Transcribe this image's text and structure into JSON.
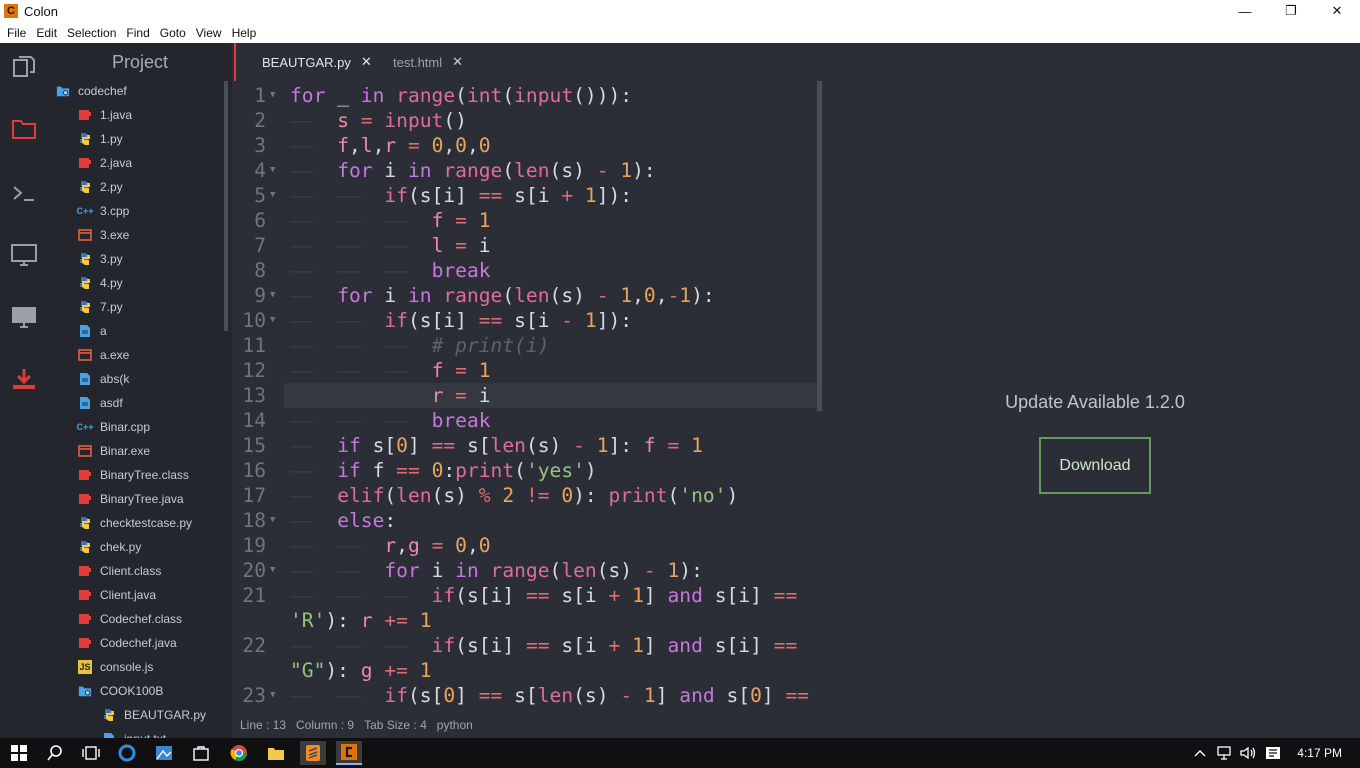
{
  "window": {
    "title": "Colon",
    "logo_letter": "C",
    "minimize": "—",
    "maximize": "❐",
    "close": "✕"
  },
  "menu": [
    "File",
    "Edit",
    "Selection",
    "Find",
    "Goto",
    "View",
    "Help"
  ],
  "sidebar": {
    "title": "Project",
    "items": [
      {
        "label": "codechef",
        "type": "folder"
      },
      {
        "label": "1.java",
        "type": "java"
      },
      {
        "label": "1.py",
        "type": "py"
      },
      {
        "label": "2.java",
        "type": "java"
      },
      {
        "label": "2.py",
        "type": "py"
      },
      {
        "label": "3.cpp",
        "type": "cpp"
      },
      {
        "label": "3.exe",
        "type": "exe"
      },
      {
        "label": "3.py",
        "type": "py"
      },
      {
        "label": "4.py",
        "type": "py"
      },
      {
        "label": "7.py",
        "type": "py"
      },
      {
        "label": "a",
        "type": "file"
      },
      {
        "label": "a.exe",
        "type": "exe"
      },
      {
        "label": "abs(k",
        "type": "file"
      },
      {
        "label": "asdf",
        "type": "file"
      },
      {
        "label": "Binar.cpp",
        "type": "cpp"
      },
      {
        "label": "Binar.exe",
        "type": "exe"
      },
      {
        "label": "BinaryTree.class",
        "type": "java"
      },
      {
        "label": "BinaryTree.java",
        "type": "java"
      },
      {
        "label": "checktestcase.py",
        "type": "py"
      },
      {
        "label": "chek.py",
        "type": "py"
      },
      {
        "label": "Client.class",
        "type": "java"
      },
      {
        "label": "Client.java",
        "type": "java"
      },
      {
        "label": "Codechef.class",
        "type": "java"
      },
      {
        "label": "Codechef.java",
        "type": "java"
      },
      {
        "label": "console.js",
        "type": "js"
      },
      {
        "label": "COOK100B",
        "type": "folder"
      },
      {
        "label": "BEAUTGAR.py",
        "type": "py"
      },
      {
        "label": "input.txt",
        "type": "file"
      }
    ]
  },
  "tabs": [
    {
      "label": "BEAUTGAR.py",
      "close": "✕",
      "active": true
    },
    {
      "label": "test.html",
      "close": "✕",
      "active": false
    }
  ],
  "editor": {
    "lines": [
      {
        "n": "1",
        "fold": "▼",
        "code": [
          [
            "kw",
            "for "
          ],
          [
            "",
            "_ "
          ],
          [
            "kw",
            "in "
          ],
          [
            "fn",
            "range"
          ],
          [
            "",
            "("
          ],
          [
            "fn",
            "int"
          ],
          [
            "",
            "("
          ],
          [
            "fn",
            "input"
          ],
          [
            "",
            "())):"
          ]
        ]
      },
      {
        "n": "2",
        "fold": "",
        "code": [
          [
            "guide",
            "——  "
          ],
          [
            "var",
            "s "
          ],
          [
            "op",
            "= "
          ],
          [
            "fn",
            "input"
          ],
          [
            "",
            "()"
          ]
        ]
      },
      {
        "n": "3",
        "fold": "",
        "code": [
          [
            "guide",
            "——  "
          ],
          [
            "var",
            "f"
          ],
          [
            "",
            ","
          ],
          [
            "var",
            "l"
          ],
          [
            "",
            ","
          ],
          [
            "var",
            "r "
          ],
          [
            "op",
            "= "
          ],
          [
            "num",
            "0"
          ],
          [
            "",
            ","
          ],
          [
            "num",
            "0"
          ],
          [
            "",
            ","
          ],
          [
            "num",
            "0"
          ]
        ]
      },
      {
        "n": "4",
        "fold": "▼",
        "code": [
          [
            "guide",
            "——  "
          ],
          [
            "kw",
            "for "
          ],
          [
            "",
            "i "
          ],
          [
            "kw",
            "in "
          ],
          [
            "fn",
            "range"
          ],
          [
            "",
            "("
          ],
          [
            "fn",
            "len"
          ],
          [
            "",
            "(s) "
          ],
          [
            "op",
            "- "
          ],
          [
            "num",
            "1"
          ],
          [
            "",
            "):"
          ]
        ]
      },
      {
        "n": "5",
        "fold": "▼",
        "code": [
          [
            "guide",
            "——  ——  "
          ],
          [
            "fn",
            "if"
          ],
          [
            "",
            "(s[i] "
          ],
          [
            "op",
            "== "
          ],
          [
            "",
            "s[i "
          ],
          [
            "op",
            "+ "
          ],
          [
            "num",
            "1"
          ],
          [
            "",
            "]):"
          ]
        ]
      },
      {
        "n": "6",
        "fold": "",
        "code": [
          [
            "guide",
            "——  ——  ——  "
          ],
          [
            "var",
            "f "
          ],
          [
            "op",
            "= "
          ],
          [
            "num",
            "1"
          ]
        ]
      },
      {
        "n": "7",
        "fold": "",
        "code": [
          [
            "guide",
            "——  ——  ——  "
          ],
          [
            "var",
            "l "
          ],
          [
            "op",
            "= "
          ],
          [
            "",
            "i"
          ]
        ]
      },
      {
        "n": "8",
        "fold": "",
        "code": [
          [
            "guide",
            "——  ——  ——  "
          ],
          [
            "kw",
            "break"
          ]
        ]
      },
      {
        "n": "9",
        "fold": "▼",
        "code": [
          [
            "guide",
            "——  "
          ],
          [
            "kw",
            "for "
          ],
          [
            "",
            "i "
          ],
          [
            "kw",
            "in "
          ],
          [
            "fn",
            "range"
          ],
          [
            "",
            "("
          ],
          [
            "fn",
            "len"
          ],
          [
            "",
            "(s) "
          ],
          [
            "op",
            "- "
          ],
          [
            "num",
            "1"
          ],
          [
            "",
            ","
          ],
          [
            "num",
            "0"
          ],
          [
            "",
            ","
          ],
          [
            "op",
            "-"
          ],
          [
            "num",
            "1"
          ],
          [
            "",
            "):"
          ]
        ]
      },
      {
        "n": "10",
        "fold": "▼",
        "code": [
          [
            "guide",
            "——  ——  "
          ],
          [
            "fn",
            "if"
          ],
          [
            "",
            "(s[i] "
          ],
          [
            "op",
            "== "
          ],
          [
            "",
            "s[i "
          ],
          [
            "op",
            "- "
          ],
          [
            "num",
            "1"
          ],
          [
            "",
            "]):"
          ]
        ]
      },
      {
        "n": "11",
        "fold": "",
        "code": [
          [
            "guide",
            "——  ——  ——  "
          ],
          [
            "cm",
            "# print(i)"
          ]
        ]
      },
      {
        "n": "12",
        "fold": "",
        "code": [
          [
            "guide",
            "——  ——  ——  "
          ],
          [
            "var",
            "f "
          ],
          [
            "op",
            "= "
          ],
          [
            "num",
            "1"
          ]
        ]
      },
      {
        "n": "13",
        "fold": "",
        "code": [
          [
            "guide",
            "——  ——  ——  "
          ],
          [
            "var",
            "r "
          ],
          [
            "op",
            "= "
          ],
          [
            "",
            "i"
          ]
        ]
      },
      {
        "n": "14",
        "fold": "",
        "code": [
          [
            "guide",
            "——  ——  ——  "
          ],
          [
            "kw",
            "break"
          ]
        ]
      },
      {
        "n": "15",
        "fold": "",
        "code": [
          [
            "guide",
            "——  "
          ],
          [
            "kw",
            "if "
          ],
          [
            "",
            "s["
          ],
          [
            "num",
            "0"
          ],
          [
            "",
            "] "
          ],
          [
            "op",
            "== "
          ],
          [
            "",
            "s["
          ],
          [
            "fn",
            "len"
          ],
          [
            "",
            "(s) "
          ],
          [
            "op",
            "- "
          ],
          [
            "num",
            "1"
          ],
          [
            "",
            "]: "
          ],
          [
            "var",
            "f "
          ],
          [
            "op",
            "= "
          ],
          [
            "num",
            "1"
          ]
        ]
      },
      {
        "n": "16",
        "fold": "",
        "code": [
          [
            "guide",
            "——  "
          ],
          [
            "kw",
            "if "
          ],
          [
            "",
            "f "
          ],
          [
            "op",
            "== "
          ],
          [
            "num",
            "0"
          ],
          [
            "",
            ":"
          ],
          [
            "fn",
            "print"
          ],
          [
            "",
            "("
          ],
          [
            "str",
            "'yes'"
          ],
          [
            "",
            ")"
          ]
        ]
      },
      {
        "n": "17",
        "fold": "",
        "code": [
          [
            "guide",
            "——  "
          ],
          [
            "fn",
            "elif"
          ],
          [
            "",
            "("
          ],
          [
            "fn",
            "len"
          ],
          [
            "",
            "(s) "
          ],
          [
            "op",
            "% "
          ],
          [
            "num",
            "2 "
          ],
          [
            "op",
            "!= "
          ],
          [
            "num",
            "0"
          ],
          [
            "",
            "): "
          ],
          [
            "fn",
            "print"
          ],
          [
            "",
            "("
          ],
          [
            "str",
            "'no'"
          ],
          [
            "",
            ")"
          ]
        ]
      },
      {
        "n": "18",
        "fold": "▼",
        "code": [
          [
            "guide",
            "——  "
          ],
          [
            "kw",
            "else"
          ],
          [
            "",
            ":"
          ]
        ]
      },
      {
        "n": "19",
        "fold": "",
        "code": [
          [
            "guide",
            "——  ——  "
          ],
          [
            "var",
            "r"
          ],
          [
            "",
            ","
          ],
          [
            "var",
            "g "
          ],
          [
            "op",
            "= "
          ],
          [
            "num",
            "0"
          ],
          [
            "",
            ","
          ],
          [
            "num",
            "0"
          ]
        ]
      },
      {
        "n": "20",
        "fold": "▼",
        "code": [
          [
            "guide",
            "——  ——  "
          ],
          [
            "kw",
            "for "
          ],
          [
            "",
            "i "
          ],
          [
            "kw",
            "in "
          ],
          [
            "fn",
            "range"
          ],
          [
            "",
            "("
          ],
          [
            "fn",
            "len"
          ],
          [
            "",
            "(s) "
          ],
          [
            "op",
            "- "
          ],
          [
            "num",
            "1"
          ],
          [
            "",
            "):"
          ]
        ]
      },
      {
        "n": "21",
        "fold": "",
        "code": [
          [
            "guide",
            "——  ——  ——  "
          ],
          [
            "fn",
            "if"
          ],
          [
            "",
            "(s[i] "
          ],
          [
            "op",
            "== "
          ],
          [
            "",
            "s[i "
          ],
          [
            "op",
            "+ "
          ],
          [
            "num",
            "1"
          ],
          [
            "",
            "] "
          ],
          [
            "kw",
            "and "
          ],
          [
            "",
            "s[i] "
          ],
          [
            "op",
            "=="
          ]
        ]
      },
      {
        "n": "",
        "fold": "",
        "code": [
          [
            "str",
            "'R'"
          ],
          [
            "",
            "): "
          ],
          [
            "var",
            "r "
          ],
          [
            "op",
            "+= "
          ],
          [
            "num",
            "1"
          ]
        ]
      },
      {
        "n": "22",
        "fold": "",
        "code": [
          [
            "guide",
            "——  ——  ——  "
          ],
          [
            "fn",
            "if"
          ],
          [
            "",
            "(s[i] "
          ],
          [
            "op",
            "== "
          ],
          [
            "",
            "s[i "
          ],
          [
            "op",
            "+ "
          ],
          [
            "num",
            "1"
          ],
          [
            "",
            "] "
          ],
          [
            "kw",
            "and "
          ],
          [
            "",
            "s[i] "
          ],
          [
            "op",
            "=="
          ]
        ]
      },
      {
        "n": "",
        "fold": "",
        "code": [
          [
            "str",
            "\"G\""
          ],
          [
            "",
            "): "
          ],
          [
            "var",
            "g "
          ],
          [
            "op",
            "+= "
          ],
          [
            "num",
            "1"
          ]
        ]
      },
      {
        "n": "23",
        "fold": "▼",
        "code": [
          [
            "guide",
            "——  ——  "
          ],
          [
            "fn",
            "if"
          ],
          [
            "",
            "(s["
          ],
          [
            "num",
            "0"
          ],
          [
            "",
            "] "
          ],
          [
            "op",
            "== "
          ],
          [
            "",
            "s["
          ],
          [
            "fn",
            "len"
          ],
          [
            "",
            "(s) "
          ],
          [
            "op",
            "- "
          ],
          [
            "num",
            "1"
          ],
          [
            "",
            "] "
          ],
          [
            "kw",
            "and "
          ],
          [
            "",
            "s["
          ],
          [
            "num",
            "0"
          ],
          [
            "",
            "] "
          ],
          [
            "op",
            "=="
          ]
        ]
      }
    ]
  },
  "status": {
    "line": "Line : 13",
    "column": "Column : 9",
    "tab_size": "Tab Size : 4",
    "language": "python"
  },
  "update": {
    "message": "Update Available 1.2.0",
    "button": "Download"
  },
  "taskbar": {
    "time": "4:17 PM"
  }
}
